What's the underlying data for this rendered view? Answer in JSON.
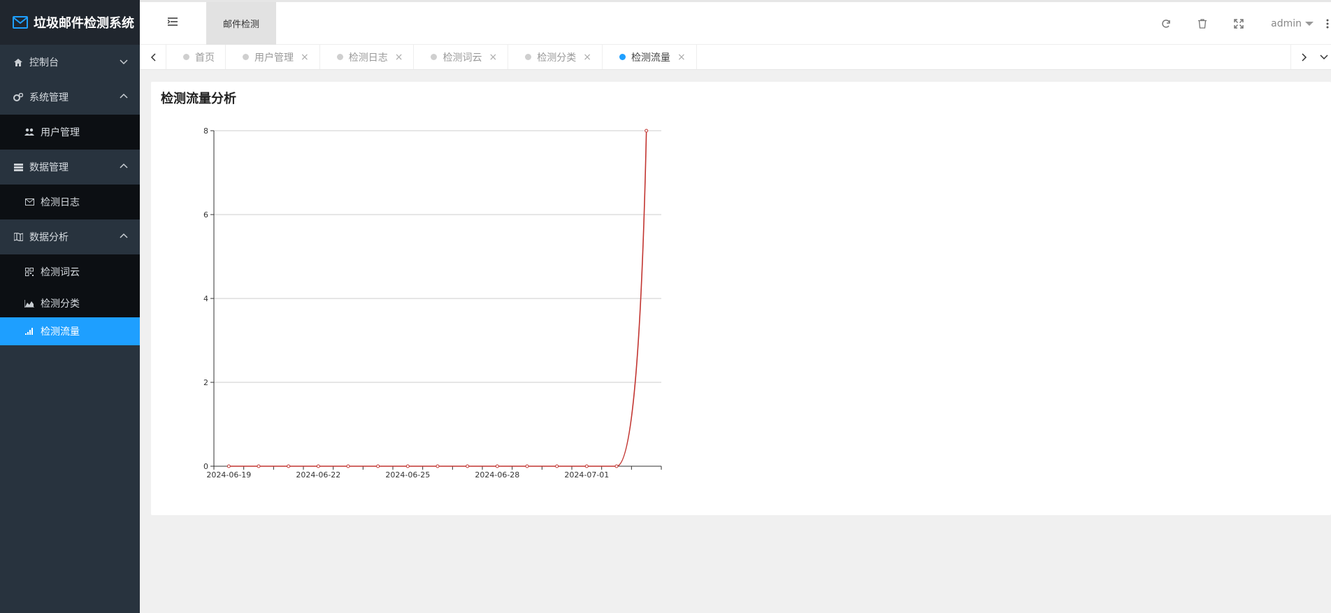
{
  "app": {
    "title": "垃圾邮件检测系统"
  },
  "colors": {
    "sidebar": "#28333e",
    "accent": "#1e9fff",
    "line": "#c23531"
  },
  "sidebar": {
    "items": [
      {
        "label": "控制台",
        "icon": "home-icon",
        "arrow": "down"
      },
      {
        "label": "系统管理",
        "icon": "gears-icon",
        "arrow": "up"
      },
      {
        "label": "用户管理",
        "icon": "users-icon",
        "sub": true
      },
      {
        "label": "数据管理",
        "icon": "server-icon",
        "arrow": "up"
      },
      {
        "label": "检测日志",
        "icon": "envelope-icon",
        "sub": true
      },
      {
        "label": "数据分析",
        "icon": "map-icon",
        "arrow": "up"
      },
      {
        "label": "检测词云",
        "icon": "grid-icon",
        "sub": true
      },
      {
        "label": "检测分类",
        "icon": "area-chart-icon",
        "sub": true
      },
      {
        "label": "检测流量",
        "icon": "signal-icon",
        "sub": true,
        "active": true
      }
    ]
  },
  "header": {
    "breadcrumb": "邮件检测",
    "user": "admin"
  },
  "tabs": [
    {
      "label": "首页",
      "closable": false
    },
    {
      "label": "用户管理",
      "closable": true
    },
    {
      "label": "检测日志",
      "closable": true
    },
    {
      "label": "检测词云",
      "closable": true
    },
    {
      "label": "检测分类",
      "closable": true
    },
    {
      "label": "检测流量",
      "closable": true,
      "active": true
    }
  ],
  "tab_close_glyph": "×",
  "main": {
    "title": "检测流量分析"
  },
  "chart_data": {
    "type": "line",
    "x": [
      "2024-06-19",
      "2024-06-20",
      "2024-06-21",
      "2024-06-22",
      "2024-06-23",
      "2024-06-24",
      "2024-06-25",
      "2024-06-26",
      "2024-06-27",
      "2024-06-28",
      "2024-06-29",
      "2024-06-30",
      "2024-07-01",
      "2024-07-02",
      "2024-07-03"
    ],
    "values": [
      0,
      0,
      0,
      0,
      0,
      0,
      0,
      0,
      0,
      0,
      0,
      0,
      0,
      0,
      8
    ],
    "x_tick_labels": [
      "2024-06-19",
      "2024-06-22",
      "2024-06-25",
      "2024-06-28",
      "2024-07-01"
    ],
    "y_ticks": [
      0,
      2,
      4,
      6,
      8
    ],
    "ylim": [
      0,
      8
    ],
    "grid": true,
    "legend": false
  }
}
